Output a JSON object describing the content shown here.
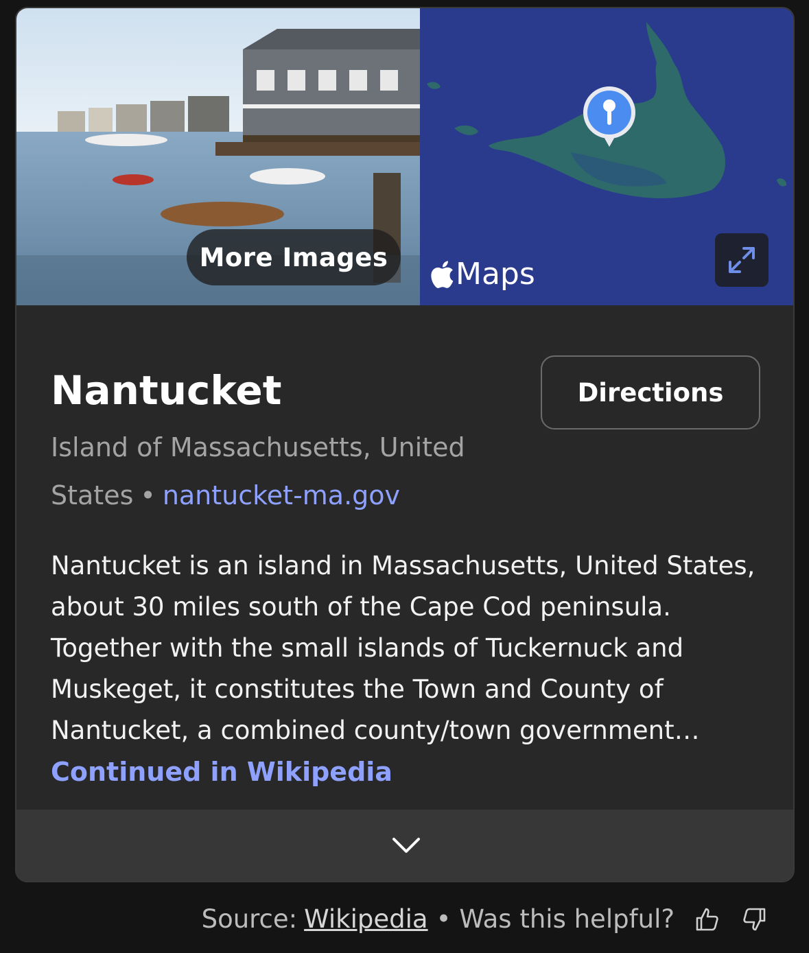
{
  "media": {
    "more_images_label": "More Images",
    "maps_label": "Maps",
    "icons": [
      "apple-logo-icon",
      "expand-icon",
      "map-pin-icon"
    ],
    "map_colors": {
      "water": "#2a3a8c",
      "land": "#2e6a6a",
      "pin": "#4a8cf0"
    }
  },
  "place": {
    "title": "Nantucket",
    "subtitle": "Island of Massachusetts, United States",
    "website": "nantucket-ma.gov",
    "directions_label": "Directions"
  },
  "description": {
    "text": "Nantucket is an island in Massachusetts, United States, about 30 miles south of the Cape Cod peninsula. Together with the small islands of Tuckernuck and Muskeget, it constitutes the Town and County of Nantucket, a combined county/town government…",
    "more_link": "Continued in Wikipedia"
  },
  "footer": {
    "source_prefix": "Source:",
    "source_link": "Wikipedia",
    "helpful_question": "Was this helpful?",
    "icons": [
      "thumbs-up-icon",
      "thumbs-down-icon"
    ]
  },
  "colors": {
    "accent_link": "#8ea1ff",
    "card_bg": "#282828",
    "page_bg": "#141414"
  }
}
